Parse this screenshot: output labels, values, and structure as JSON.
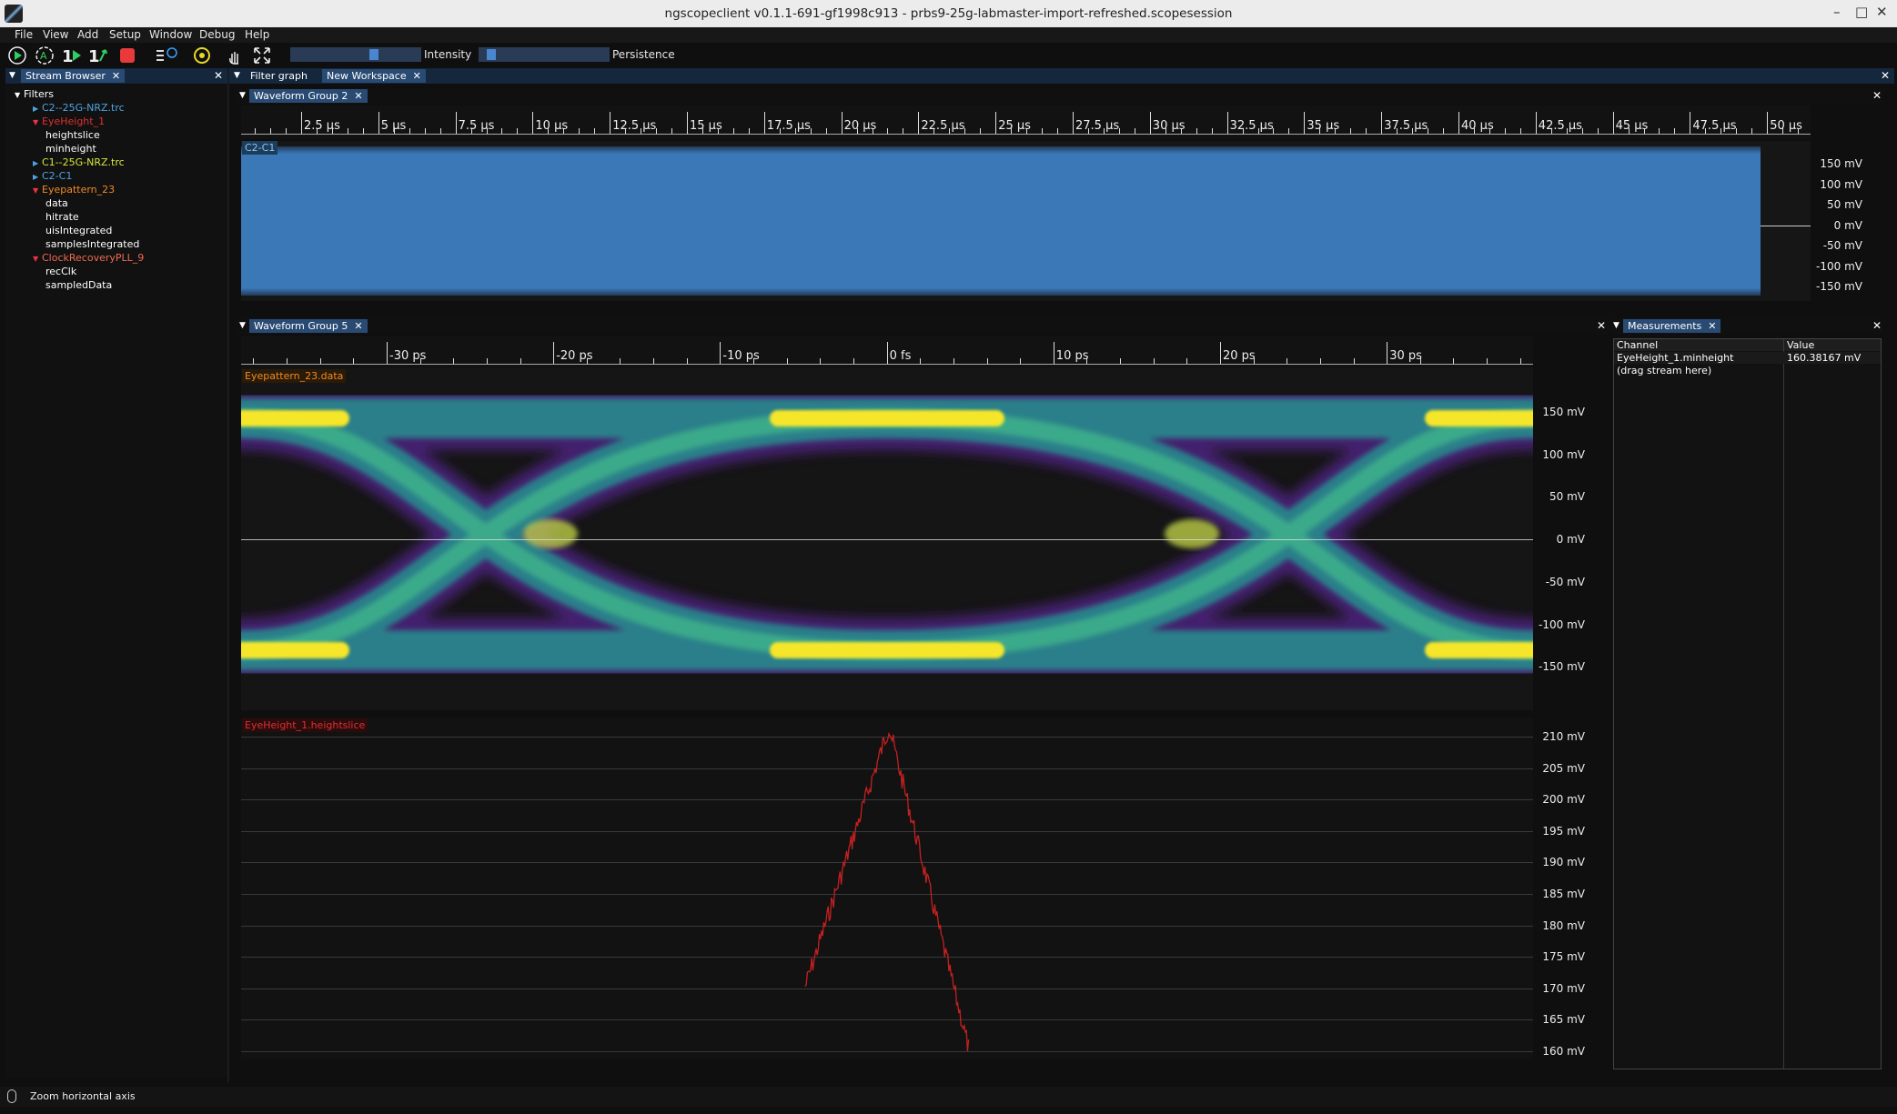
{
  "window": {
    "title": "ngscopeclient v0.1.1-691-gf1998c913  - prbs9-25g-labmaster-import-refreshed.scopesession",
    "controls": [
      "–",
      "□",
      "✕"
    ]
  },
  "menu": [
    "File",
    "View",
    "Add",
    "Setup",
    "Window",
    "Debug",
    "Help"
  ],
  "toolbar": {
    "icons": [
      "play-icon",
      "auto-trigger-icon",
      "single-trigger-icon",
      "force-trigger-icon",
      "stop-icon",
      "timebase-icon",
      "trigger-settings-icon",
      "touch-icon",
      "fullscreen-icon"
    ],
    "intensity_label": "Intensity",
    "intensity_value": 0.65,
    "persistence_label": "Persistence",
    "persistence_value": 0.05
  },
  "stream_browser": {
    "tab": "Stream Browser",
    "root": "Filters",
    "items": [
      {
        "label": "C2--25G-NRZ.trc",
        "color": "#4fa3e0",
        "expanded": false,
        "depth": 1
      },
      {
        "label": "EyeHeight_1",
        "color": "#e03030",
        "expanded": true,
        "depth": 1
      },
      {
        "label": "heightslice",
        "color": "#ffffff",
        "depth": 2
      },
      {
        "label": "minheight",
        "color": "#ffffff",
        "depth": 2
      },
      {
        "label": "C1--25G-NRZ.trc",
        "color": "#d8e53a",
        "expanded": false,
        "depth": 1
      },
      {
        "label": "C2-C1",
        "color": "#4fa3e0",
        "expanded": false,
        "depth": 1
      },
      {
        "label": "Eyepattern_23",
        "color": "#f08a24",
        "expanded": true,
        "depth": 1
      },
      {
        "label": "data",
        "color": "#ffffff",
        "depth": 2
      },
      {
        "label": "hitrate",
        "color": "#ffffff",
        "depth": 2
      },
      {
        "label": "uisIntegrated",
        "color": "#ffffff",
        "depth": 2
      },
      {
        "label": "samplesIntegrated",
        "color": "#ffffff",
        "depth": 2
      },
      {
        "label": "ClockRecoveryPLL_9",
        "color": "#f06a50",
        "expanded": true,
        "depth": 1
      },
      {
        "label": "recClk",
        "color": "#ffffff",
        "depth": 2
      },
      {
        "label": "sampledData",
        "color": "#ffffff",
        "depth": 2
      }
    ]
  },
  "top_tabs": {
    "filter_graph": "Filter graph",
    "workspace": "New Workspace"
  },
  "group2": {
    "tab": "Waveform Group 2",
    "channel": "C2-C1",
    "x_ticks": [
      "2.5 µs",
      "5 µs",
      "7.5 µs",
      "10 µs",
      "12.5 µs",
      "15 µs",
      "17.5 µs",
      "20 µs",
      "22.5 µs",
      "25 µs",
      "27.5 µs",
      "30 µs",
      "32.5 µs",
      "35 µs",
      "37.5 µs",
      "40 µs",
      "42.5 µs",
      "45 µs",
      "47.5 µs",
      "50 µs"
    ],
    "y_ticks": [
      "150 mV",
      "100 mV",
      "50 mV",
      "0 mV",
      "-50 mV",
      "-100 mV",
      "-150 mV"
    ]
  },
  "group5": {
    "tab": "Waveform Group 5",
    "x_ticks": [
      "-30 ps",
      "-20 ps",
      "-10 ps",
      "0 fs",
      "10 ps",
      "20 ps",
      "30 ps"
    ],
    "eye_channel": "Eyepattern_23.data",
    "eye_y_ticks": [
      "150 mV",
      "100 mV",
      "50 mV",
      "0 mV",
      "-50 mV",
      "-100 mV",
      "-150 mV"
    ],
    "slice_channel": "EyeHeight_1.heightslice",
    "slice_y_ticks": [
      "210 mV",
      "205 mV",
      "200 mV",
      "195 mV",
      "190 mV",
      "185 mV",
      "180 mV",
      "175 mV",
      "170 mV",
      "165 mV",
      "160 mV"
    ]
  },
  "measurements": {
    "tab": "Measurements",
    "columns": [
      "Channel",
      "Value"
    ],
    "rows": [
      {
        "channel": "EyeHeight_1.minheight",
        "value": "160.38167 mV"
      },
      {
        "channel": "(drag stream here)",
        "value": ""
      }
    ]
  },
  "status": {
    "text": "Zoom horizontal axis"
  },
  "colors": {
    "accent": "#294a73",
    "waveform_blue": "#3a78b8",
    "eye_yellow": "#f6e62a",
    "eye_teal": "#2d9b8a",
    "eye_purple": "#5a2a8a",
    "slice_red": "#c42020"
  }
}
